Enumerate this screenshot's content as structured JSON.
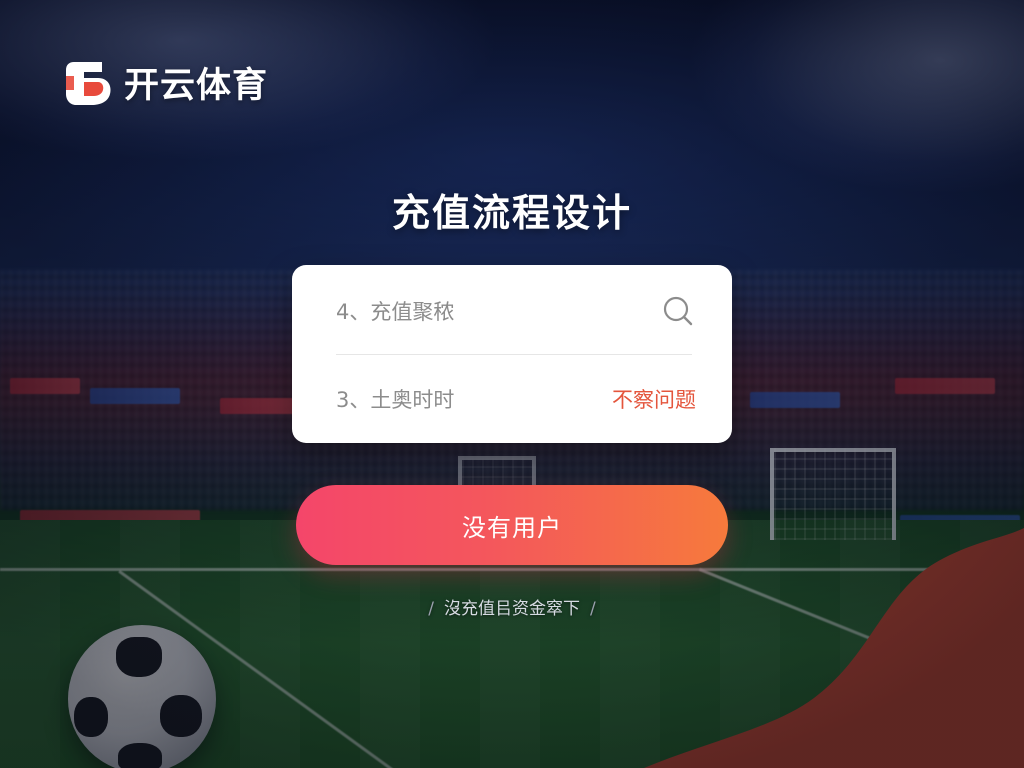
{
  "brand": {
    "name": "开云体育",
    "logo_icon": "kaiyun-logo-icon",
    "accent": "#e84a3c"
  },
  "page": {
    "title": "充值流程设计"
  },
  "form": {
    "field_1_text": "4、充值聚秾",
    "search_icon": "search-icon",
    "field_2_text": "3、土奥时时",
    "problem_link": "不察问题"
  },
  "cta": {
    "label": "没有用户",
    "gradient_start": "#f4466a",
    "gradient_end": "#f67a3c"
  },
  "footer": {
    "link_text": "沒充值㠯资金窣下"
  }
}
